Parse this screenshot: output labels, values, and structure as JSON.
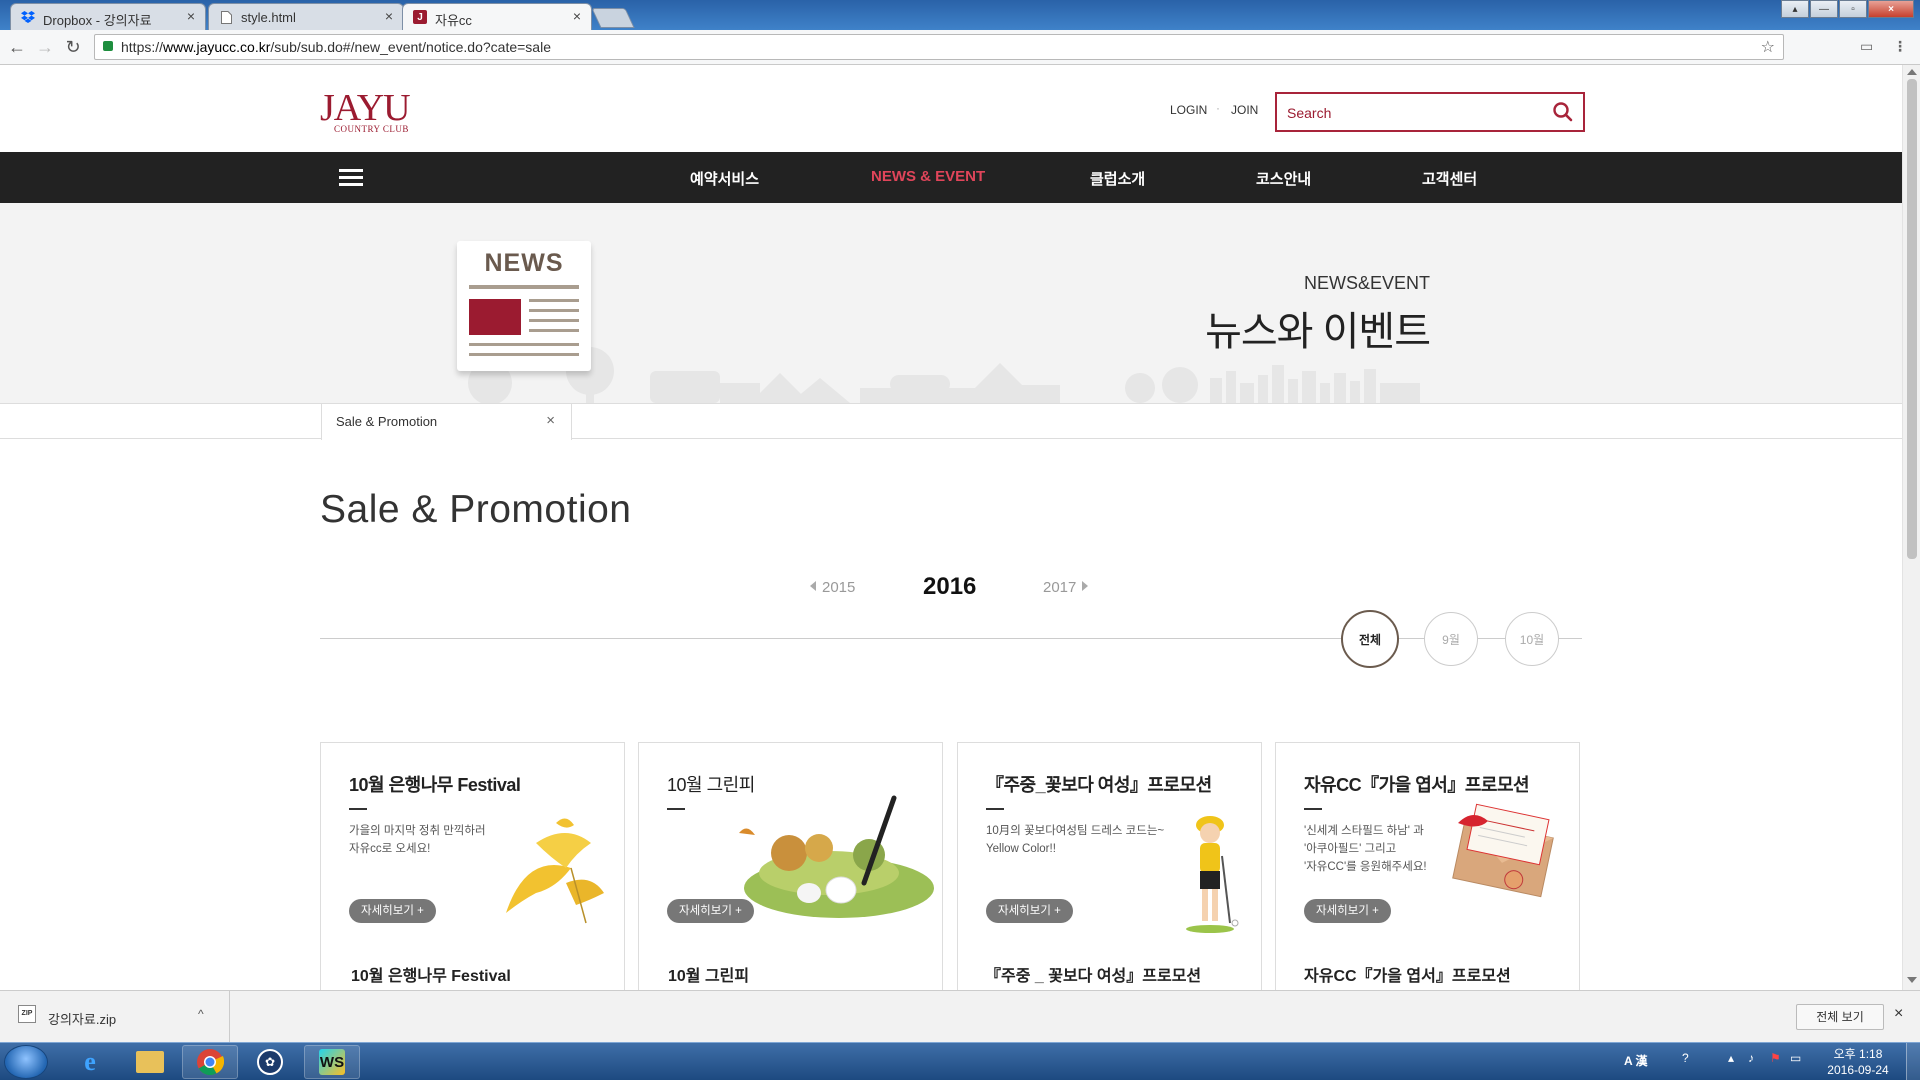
{
  "browser": {
    "tabs": [
      {
        "title": "Dropbox - 강의자료",
        "icon": "dropbox-icon",
        "active": false
      },
      {
        "title": "style.html",
        "icon": "file-icon",
        "active": false
      },
      {
        "title": "자유cc",
        "icon": "jayu-favicon",
        "active": true
      }
    ],
    "url_scheme": "https://",
    "url_host": "www.jayucc.co.kr",
    "url_path": "/sub/sub.do#/new_event/notice.do?cate=sale"
  },
  "header": {
    "logo_main": "JAYU",
    "logo_sub": "COUNTRY CLUB",
    "login_label": "LOGIN",
    "separator": "·",
    "join_label": "JOIN",
    "search_placeholder": "Search",
    "brand_color": "#9b1b30"
  },
  "nav": {
    "items": [
      {
        "label": "예약서비스",
        "active": false
      },
      {
        "label": "NEWS & EVENT",
        "active": true
      },
      {
        "label": "클럽소개",
        "active": false
      },
      {
        "label": "코스안내",
        "active": false
      },
      {
        "label": "고객센터",
        "active": false
      }
    ],
    "active_color": "#e0455a"
  },
  "banner": {
    "badge_text": "NEWS",
    "subtitle": "NEWS&EVENT",
    "title": "뉴스와 이벤트"
  },
  "subnav": {
    "tab_label": "Sale & Promotion",
    "close_glyph": "×"
  },
  "content": {
    "page_title": "Sale & Promotion",
    "year_prev": "2015",
    "year_current": "2016",
    "year_next": "2017",
    "months": [
      {
        "label": "전체",
        "active": true
      },
      {
        "label": "9월",
        "active": false
      },
      {
        "label": "10월",
        "active": false
      }
    ],
    "cards": [
      {
        "title": "10월 은행나무 Festival",
        "desc_lines": [
          "가을의 마지막 정취 만끽하러",
          "자유cc로 오세요!"
        ],
        "button": "자세히보기 +",
        "art": "ginkgo-leaf-art",
        "bottom_title": "10월 은행나무 Festival"
      },
      {
        "title": "10월 그린피",
        "desc_lines": [],
        "button": "자세히보기 +",
        "art": "golf-course-art",
        "bottom_title": "10월 그린피"
      },
      {
        "title": "『주중_꽃보다 여성』프로모션",
        "desc_lines": [
          "10月의 꽃보다여성팀 드레스 코드는~",
          "Yellow Color!!"
        ],
        "button": "자세히보기 +",
        "art": "female-golfer-art",
        "bottom_title": "『주중 _ 꽃보다 여성』프로모션"
      },
      {
        "title": "자유CC『가을 엽서』프로모션",
        "desc_lines": [
          "'신세계 스타필드 하남' 과",
          "'아쿠아필드' 그리고",
          "'자유CC'를 응원해주세요!"
        ],
        "button": "자세히보기 +",
        "art": "postcard-art",
        "bottom_title": "자유CC『가을 엽서』프로모션"
      }
    ]
  },
  "downloads": {
    "file_name": "강의자료.zip",
    "file_badge": "ZIP",
    "caret": "^",
    "show_all_label": "전체 보기",
    "close_glyph": "×"
  },
  "taskbar": {
    "apps": [
      "ie-icon",
      "explorer-icon",
      "chrome-icon",
      "app-icon",
      "webstorm-icon"
    ],
    "ime_label": "A 漢",
    "time": "오후 1:18",
    "date": "2016-09-24"
  }
}
